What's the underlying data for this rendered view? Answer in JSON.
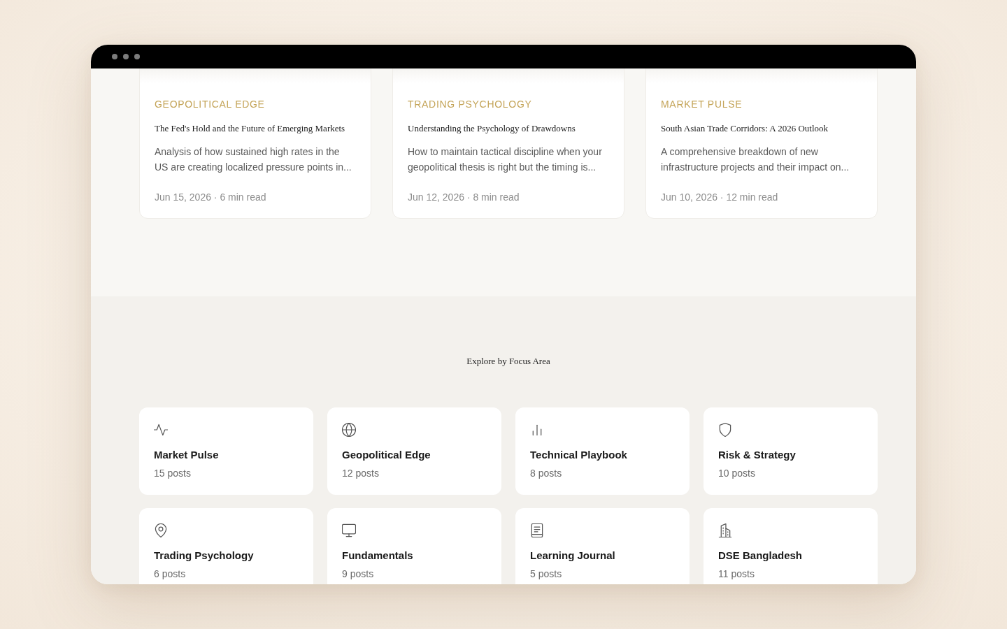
{
  "recent_articles": [
    {
      "category": "GEOPOLITICAL EDGE",
      "title": "The Fed's Hold and the Future of Emerging Markets",
      "excerpt": "Analysis of how sustained high rates in the US are creating localized pressure points in...",
      "meta": "Jun 15, 2026 · 6 min read"
    },
    {
      "category": "TRADING PSYCHOLOGY",
      "title": "Understanding the Psychology of Drawdowns",
      "excerpt": "How to maintain tactical discipline when your geopolitical thesis is right but the timing is...",
      "meta": "Jun 12, 2026 · 8 min read"
    },
    {
      "category": "MARKET PULSE",
      "title": "South Asian Trade Corridors: A 2026 Outlook",
      "excerpt": "A comprehensive breakdown of new infrastructure projects and their impact on...",
      "meta": "Jun 10, 2026 · 12 min read"
    }
  ],
  "focus_areas": {
    "heading": "Explore by Focus Area",
    "items": [
      {
        "name": "Market Pulse",
        "count": "15 posts"
      },
      {
        "name": "Geopolitical Edge",
        "count": "12 posts"
      },
      {
        "name": "Technical Playbook",
        "count": "8 posts"
      },
      {
        "name": "Risk & Strategy",
        "count": "10 posts"
      },
      {
        "name": "Trading Psychology",
        "count": "6 posts"
      },
      {
        "name": "Fundamentals",
        "count": "9 posts"
      },
      {
        "name": "Learning Journal",
        "count": "5 posts"
      },
      {
        "name": "DSE Bangladesh",
        "count": "11 posts"
      }
    ]
  }
}
